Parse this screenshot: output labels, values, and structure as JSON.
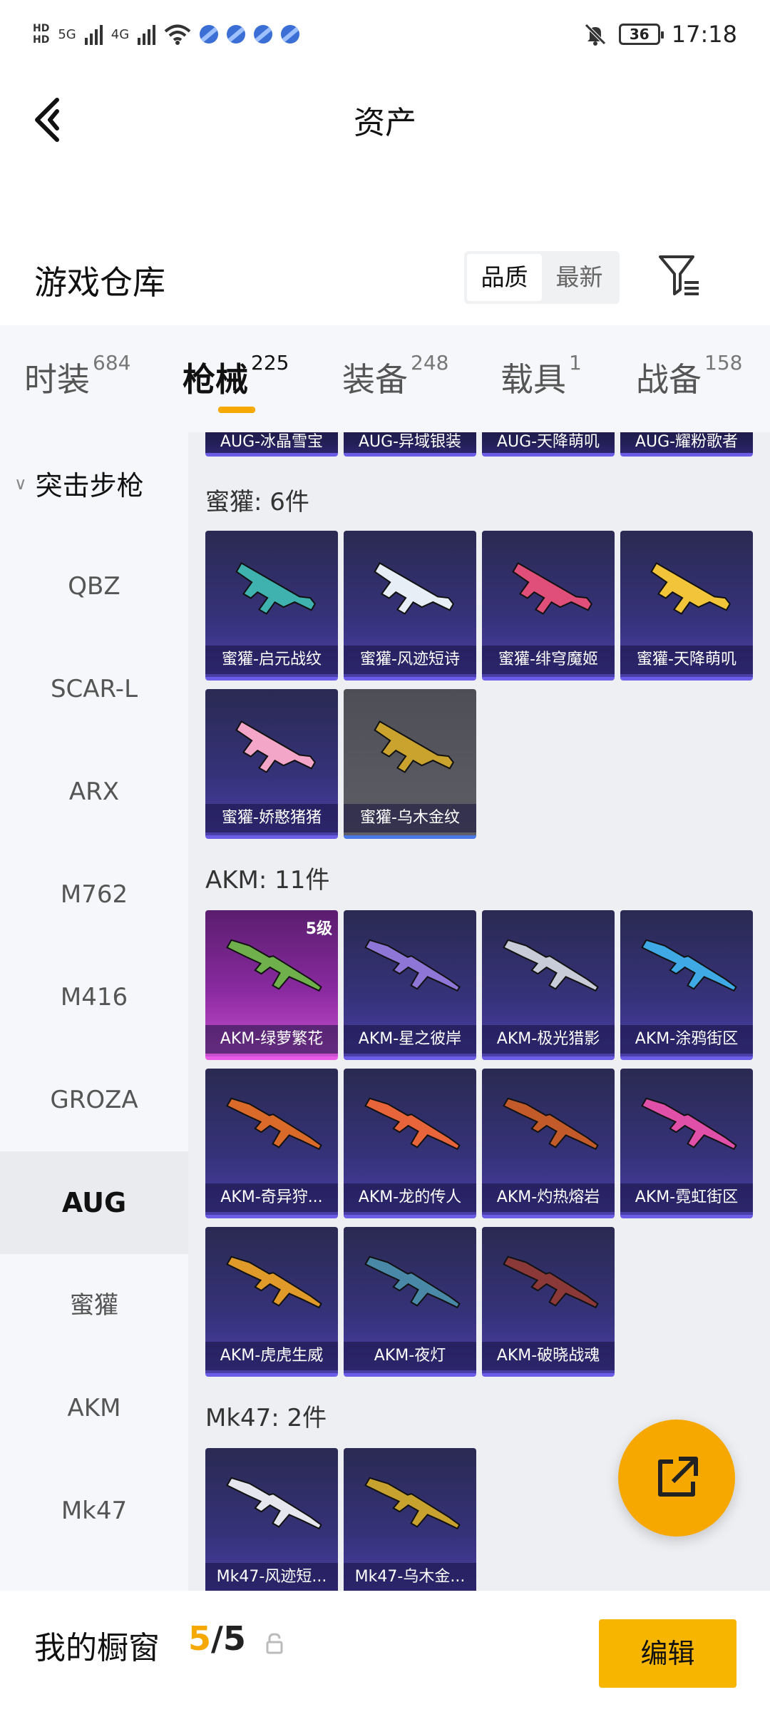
{
  "status_bar": {
    "hd_top": "HD",
    "hd_bottom": "HD",
    "net1": "5G",
    "net2": "4G",
    "battery": "36",
    "time": "17:18"
  },
  "header": {
    "title": "资产"
  },
  "warehouse": {
    "title": "游戏仓库",
    "sort_options": [
      "品质",
      "最新"
    ],
    "active_sort": "品质"
  },
  "tabs": [
    {
      "label": "时装",
      "count": "684"
    },
    {
      "label": "枪械",
      "count": "225",
      "active": true
    },
    {
      "label": "装备",
      "count": "248"
    },
    {
      "label": "载具",
      "count": "1"
    },
    {
      "label": "战备",
      "count": "158"
    }
  ],
  "sidebar": {
    "group": "突击步枪",
    "items": [
      "QBZ",
      "SCAR-L",
      "ARX",
      "M762",
      "M416",
      "GROZA",
      "AUG",
      "蜜獾",
      "AKM",
      "Mk47"
    ],
    "active": "AUG"
  },
  "top_partial_row": [
    "AUG-冰晶雪宝",
    "AUG-异域银装",
    "AUG-天降萌叽",
    "AUG-耀粉歌者"
  ],
  "groups": [
    {
      "label": "蜜獾: 6件",
      "items": [
        "蜜獾-启元战纹",
        "蜜獾-风迹短诗",
        "蜜獾-绯穹魔姬",
        "蜜獾-天降萌叽",
        "蜜獾-娇憨猪猪",
        "蜜獾-乌木金纹"
      ]
    },
    {
      "label": "AKM: 11件",
      "items": [
        "AKM-绿萝繁花",
        "AKM-星之彼岸",
        "AKM-极光猎影",
        "AKM-涂鸦街区",
        "AKM-奇异狩...",
        "AKM-龙的传人",
        "AKM-灼热熔岩",
        "AKM-霓虹街区",
        "AKM-虎虎生威",
        "AKM-夜灯",
        "AKM-破晓战魂"
      ],
      "level_badge": "5级"
    },
    {
      "label": "Mk47: 2件",
      "items": [
        "Mk47-风迹短...",
        "Mk47-乌木金..."
      ]
    }
  ],
  "gun_colors": [
    "#3fb2b0",
    "#e8eef6",
    "#e04f7a",
    "#f2c43a",
    "#f4a6c8",
    "#caa32e",
    "#6fb04c",
    "#8d76d6",
    "#c8ccd8",
    "#3fa9e6",
    "#d96a2a",
    "#e8643a",
    "#c25a2a",
    "#e04fa8",
    "#e09a2a",
    "#4a88a8",
    "#8a3838",
    "#e6e6ee",
    "#c8a22e"
  ],
  "bottom_bar": {
    "label": "我的橱窗",
    "current": "5",
    "total": "/5",
    "edit_label": "编辑"
  }
}
